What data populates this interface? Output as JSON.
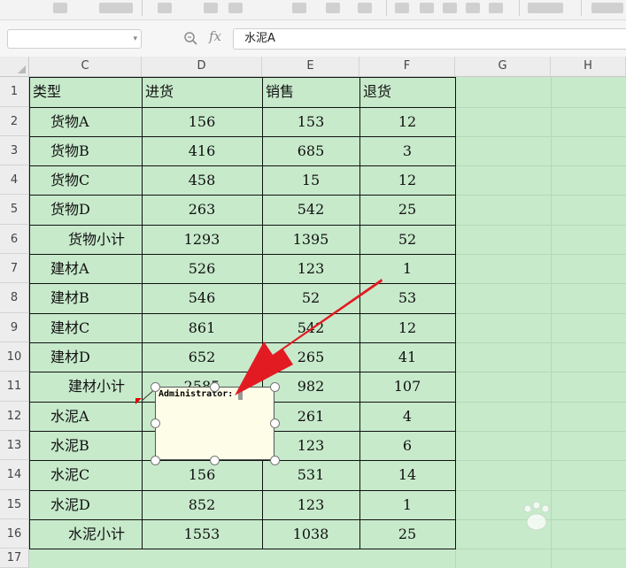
{
  "formula_bar": {
    "name_box": "",
    "formula": "水泥A"
  },
  "columns": [
    "C",
    "D",
    "E",
    "F",
    "G",
    "H"
  ],
  "rows": [
    "1",
    "2",
    "3",
    "4",
    "5",
    "6",
    "7",
    "8",
    "9",
    "10",
    "11",
    "12",
    "13",
    "14",
    "15",
    "16",
    "17"
  ],
  "table": {
    "headers": [
      "类型",
      "进货",
      "销售",
      "退货"
    ],
    "rows": [
      [
        "货物A",
        "156",
        "153",
        "12"
      ],
      [
        "货物B",
        "416",
        "685",
        "3"
      ],
      [
        "货物C",
        "458",
        "15",
        "12"
      ],
      [
        "货物D",
        "263",
        "542",
        "25"
      ],
      [
        "货物小计",
        "1293",
        "1395",
        "52"
      ],
      [
        "建材A",
        "526",
        "123",
        "1"
      ],
      [
        "建材B",
        "546",
        "52",
        "53"
      ],
      [
        "建材C",
        "861",
        "542",
        "12"
      ],
      [
        "建材D",
        "652",
        "265",
        "41"
      ],
      [
        "建材小计",
        "2585",
        "982",
        "107"
      ],
      [
        "水泥A",
        "",
        "261",
        "4"
      ],
      [
        "水泥B",
        "",
        "123",
        "6"
      ],
      [
        "水泥C",
        "156",
        "531",
        "14"
      ],
      [
        "水泥D",
        "852",
        "123",
        "1"
      ],
      [
        "水泥小计",
        "1553",
        "1038",
        "25"
      ]
    ],
    "subtotal_rows": [
      4,
      9,
      14
    ]
  },
  "comment": {
    "author": "Administrator:"
  },
  "colors": {
    "sheet_bg": "#c7eacb",
    "arrow": "#e21b23",
    "comment_bg": "#fefee8"
  }
}
